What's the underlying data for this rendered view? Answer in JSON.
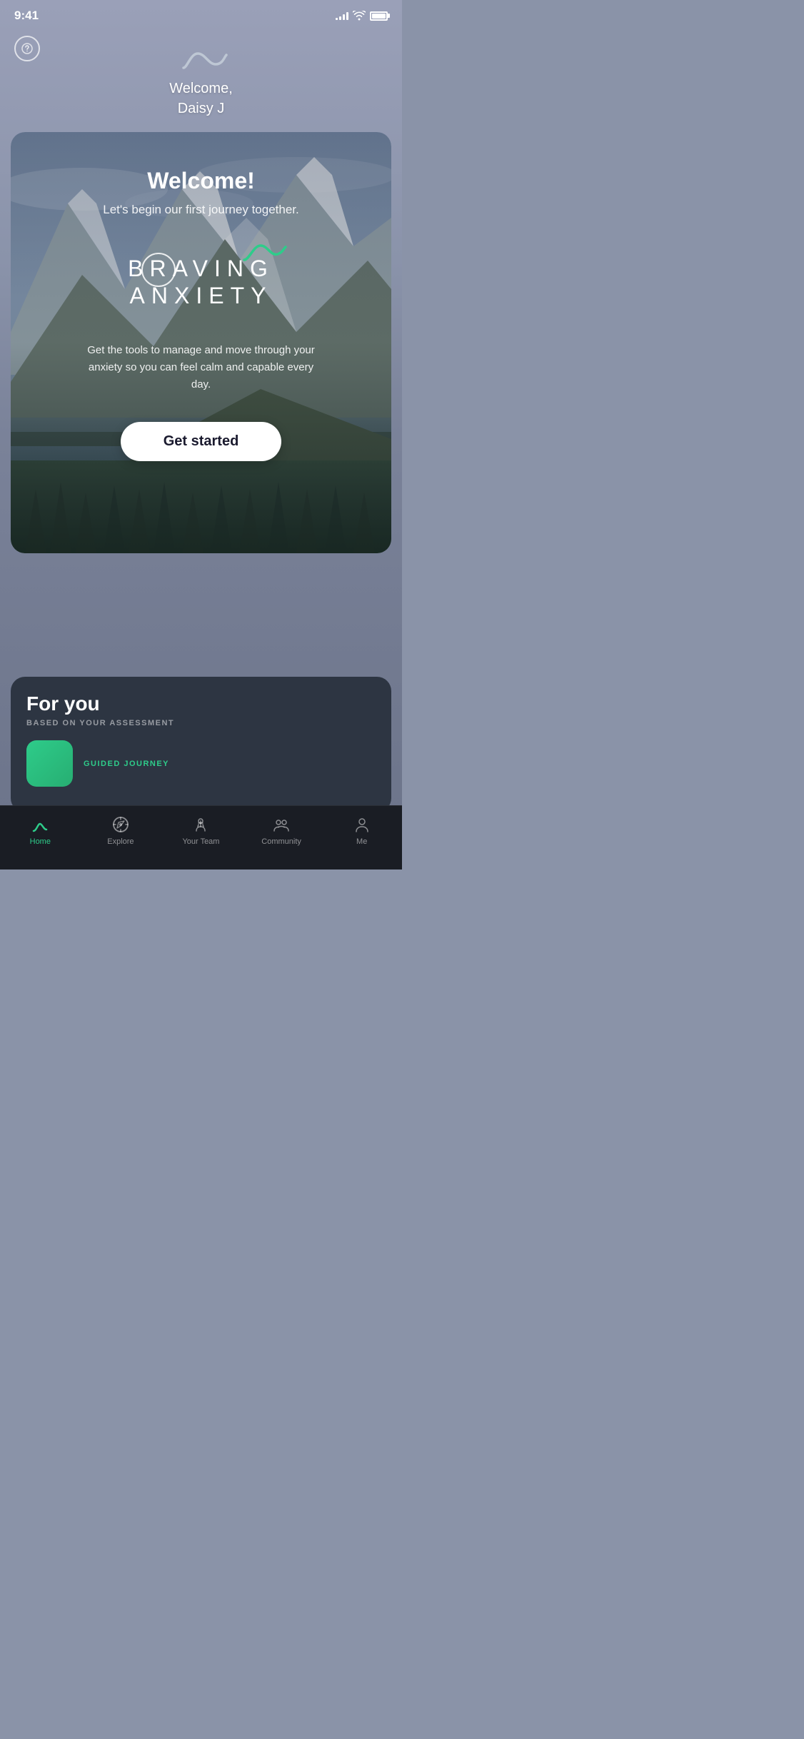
{
  "statusBar": {
    "time": "9:41",
    "signal": 4,
    "wifi": true,
    "battery": 100
  },
  "header": {
    "welcomeText": "Welcome,\nDaisy J",
    "helpIcon": "?"
  },
  "card": {
    "title": "Welcome!",
    "subtitle": "Let's begin our first journey together.",
    "logoLine1": "BRAVING",
    "logoLine2": "ANXIETY",
    "description": "Get the tools to manage and move through your anxiety so you can feel calm and capable every day.",
    "ctaButton": "Get started"
  },
  "forYou": {
    "title": "For you",
    "assessmentLabel": "BASED ON YOUR ASSESSMENT",
    "journeyType": "GUIDED JOURNEY"
  },
  "tabs": [
    {
      "id": "home",
      "label": "Home",
      "active": true
    },
    {
      "id": "explore",
      "label": "Explore",
      "active": false
    },
    {
      "id": "your-team",
      "label": "Your Team",
      "active": false
    },
    {
      "id": "community",
      "label": "Community",
      "active": false
    },
    {
      "id": "me",
      "label": "Me",
      "active": false
    }
  ],
  "colors": {
    "accent": "#2ecc8a",
    "tabActive": "#2ecc8a",
    "tabInactive": "rgba(255,255,255,0.5)",
    "cardBg": "#2d3542",
    "tabBarBg": "#1a1d24"
  }
}
